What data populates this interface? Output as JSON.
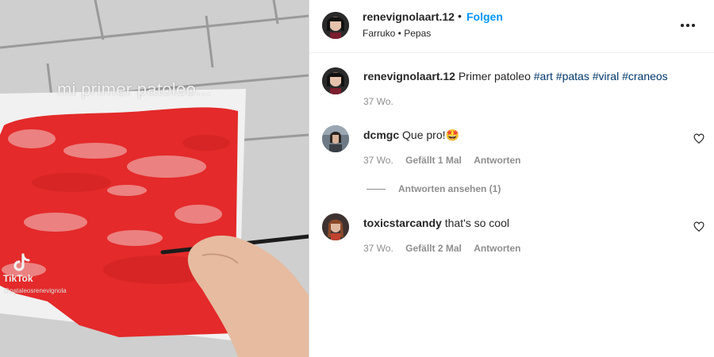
{
  "video": {
    "overlay_caption": "mi primer patoleo...",
    "watermark_brand": "TikTok",
    "watermark_handle": "@pataleosrenevignola"
  },
  "post": {
    "author": "renevignolaart.12",
    "follow_label": "Folgen",
    "audio": "Farruko • Pepas",
    "more_icon": "more-options-icon"
  },
  "caption": {
    "user": "renevignolaart.12",
    "text": "Primer patoleo",
    "tags": [
      "#art",
      "#patas",
      "#viral",
      "#craneos"
    ],
    "time": "37 Wo."
  },
  "comments": [
    {
      "user": "dcmgc",
      "text": "Que pro!🤩",
      "time": "37 Wo.",
      "likes": "Gefällt 1 Mal",
      "reply": "Antworten",
      "view_replies": "Antworten ansehen (1)"
    },
    {
      "user": "toxicstarcandy",
      "text": "that's so cool",
      "time": "37 Wo.",
      "likes": "Gefällt 2 Mal",
      "reply": "Antworten"
    }
  ],
  "colors": {
    "follow": "#0095f6",
    "hashtag": "#00376b",
    "paint": "#e42a2a",
    "muted": "#8e8e8e"
  }
}
